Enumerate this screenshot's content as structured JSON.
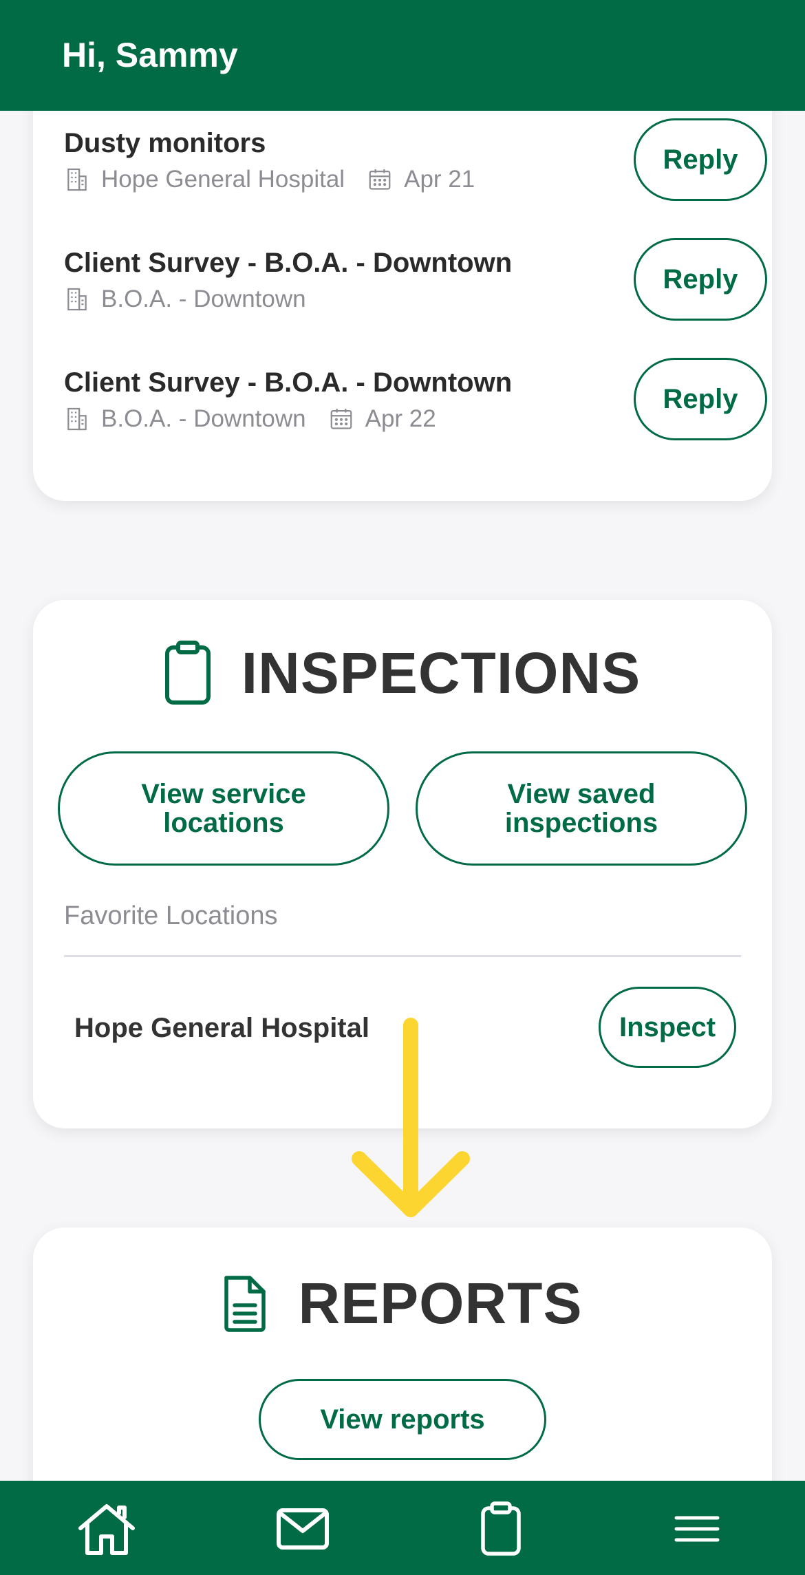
{
  "header": {
    "greeting": "Hi, Sammy"
  },
  "messages": [
    {
      "title": "Dusty monitors",
      "location": "Hope General Hospital",
      "date": "Apr 21",
      "action": "Reply"
    },
    {
      "title": "Client Survey - B.O.A. - Downtown",
      "location": "B.O.A. - Downtown",
      "date": "",
      "action": "Reply"
    },
    {
      "title": "Client Survey - B.O.A. - Downtown",
      "location": "B.O.A. - Downtown",
      "date": "Apr 22",
      "action": "Reply"
    }
  ],
  "inspections": {
    "title": "INSPECTIONS",
    "icon": "clipboard-icon",
    "view_locations_label": "View service locations",
    "view_saved_label": "View saved inspections",
    "favorites_label": "Favorite Locations",
    "favorites": [
      {
        "name": "Hope General Hospital",
        "action": "Inspect"
      }
    ]
  },
  "reports": {
    "title": "REPORTS",
    "icon": "document-icon",
    "view_reports_label": "View reports"
  },
  "bottom_nav": [
    {
      "icon": "home-icon"
    },
    {
      "icon": "mail-icon"
    },
    {
      "icon": "clipboard-icon"
    },
    {
      "icon": "menu-icon"
    }
  ],
  "colors": {
    "brand": "#006b45",
    "annotation_arrow": "#fdd530",
    "background": "#f6f6f9"
  }
}
